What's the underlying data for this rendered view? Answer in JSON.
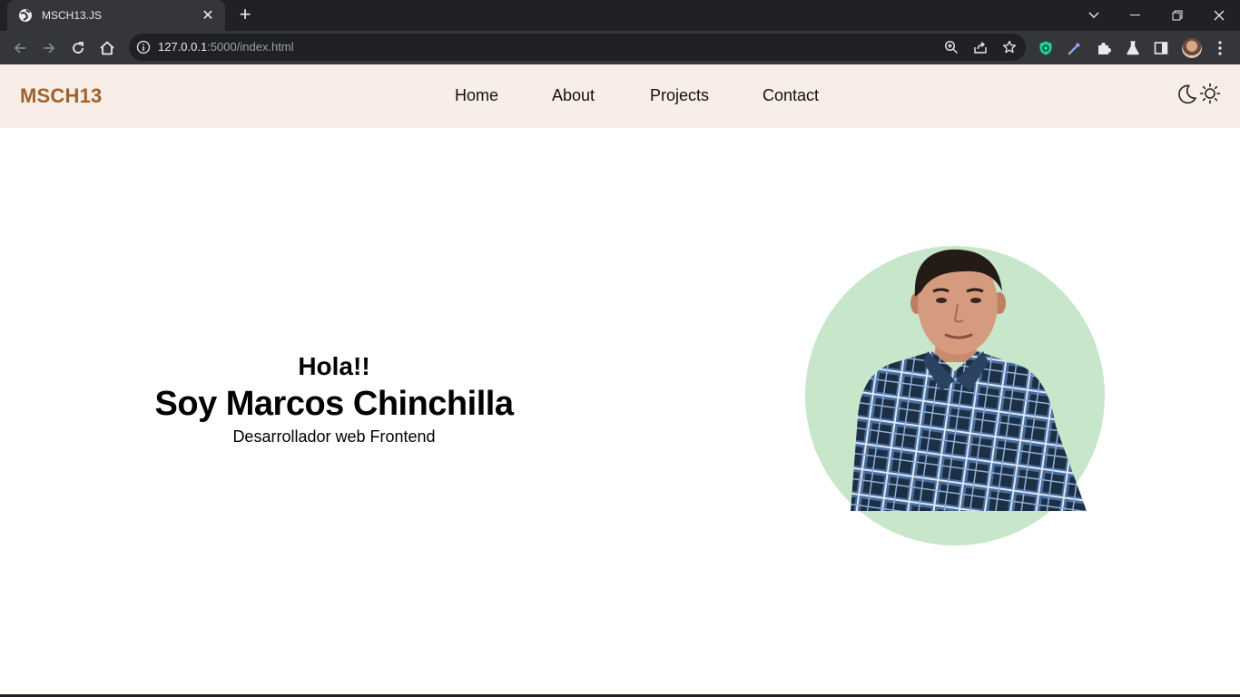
{
  "browser": {
    "tab_title": "MSCH13.JS",
    "tab_close": "✕",
    "new_tab": "+",
    "url_host": "127.0.0.1",
    "url_path": ":5000/index.html"
  },
  "nav": {
    "logo": "MSCH13",
    "items": [
      {
        "label": "Home"
      },
      {
        "label": "About"
      },
      {
        "label": "Projects"
      },
      {
        "label": "Contact"
      }
    ]
  },
  "hero": {
    "greeting": "Hola!!",
    "name": "Soy Marcos Chinchilla",
    "role": "Desarrollador web Frontend"
  },
  "colors": {
    "nav_bg": "#f8ede7",
    "logo": "#a0622a",
    "portrait_circle": "#c8e6c9",
    "shirt_dark": "#1d2f45",
    "shirt_light": "#dfe8f5"
  },
  "icons": [
    "globe-icon",
    "back-icon",
    "forward-icon",
    "reload-icon",
    "home-icon",
    "info-icon",
    "zoom-icon",
    "share-icon",
    "star-icon",
    "moon-icon",
    "sun-icon"
  ]
}
